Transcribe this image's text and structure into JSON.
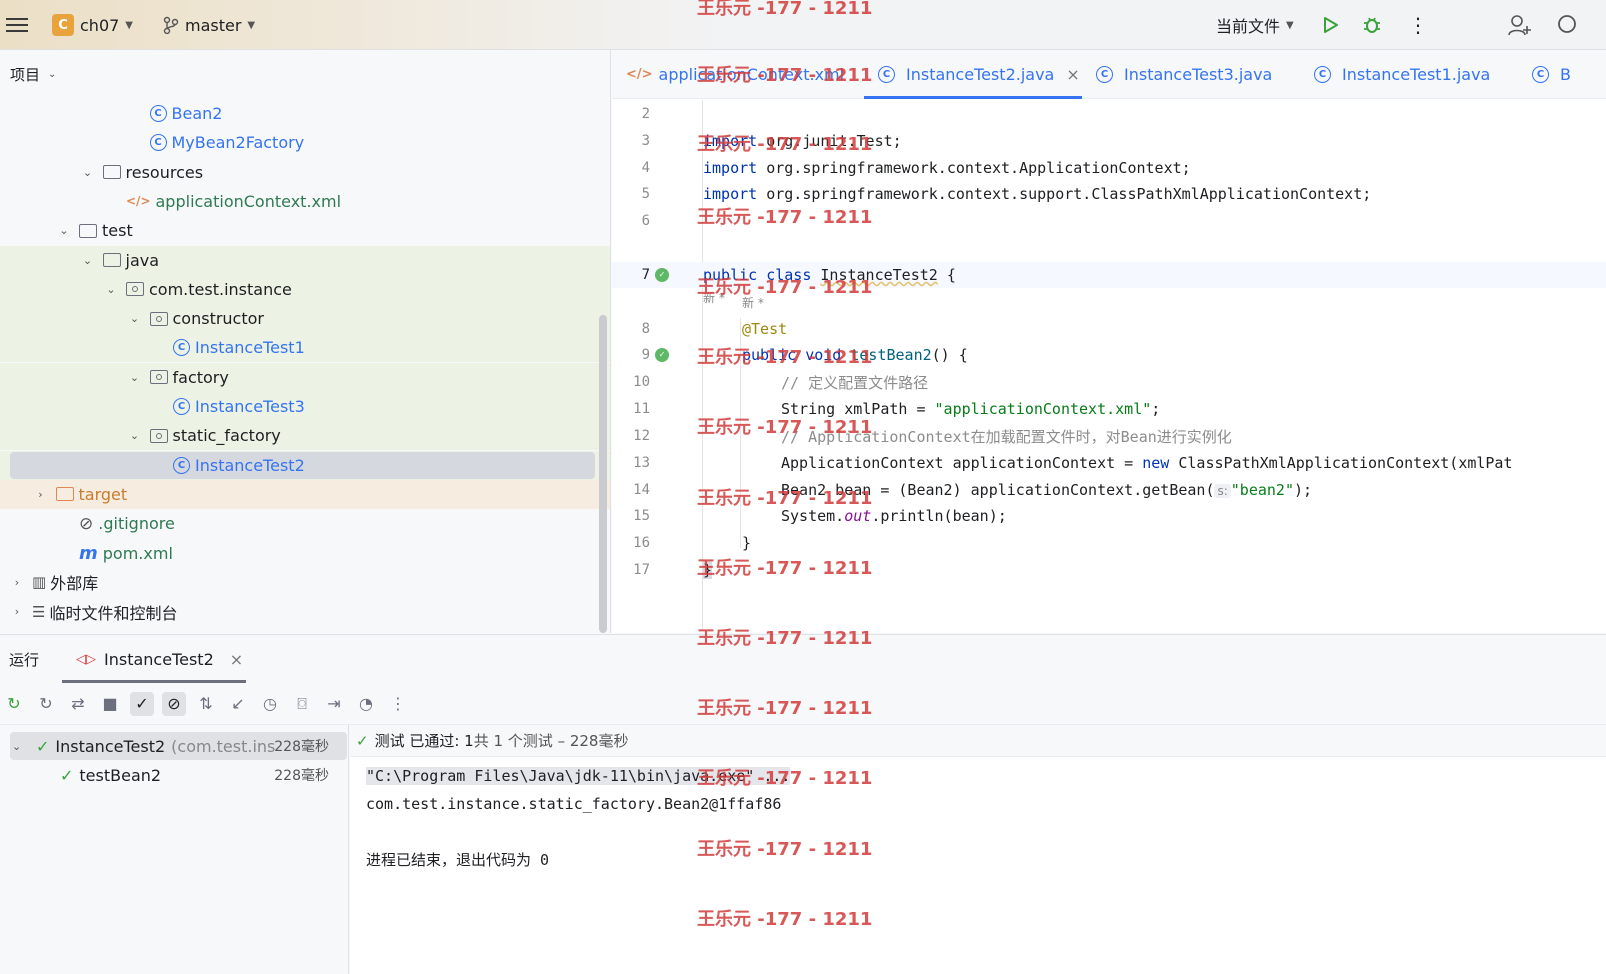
{
  "titlebar": {
    "project_badge": "C",
    "project": "ch07",
    "branch": "master",
    "run_config": "当前文件"
  },
  "left_panel": {
    "title": "项目",
    "tree": [
      {
        "label": "Bean2",
        "kind": "class",
        "indent": 5,
        "arrow": "",
        "row": "plain"
      },
      {
        "label": "MyBean2Factory",
        "kind": "class",
        "indent": 5,
        "arrow": "",
        "row": "plain"
      },
      {
        "label": "resources",
        "kind": "resfolder",
        "indent": 3,
        "arrow": "⌄",
        "row": "plain"
      },
      {
        "label": "applicationContext.xml",
        "kind": "xml",
        "indent": 4,
        "arrow": "",
        "row": "plain"
      },
      {
        "label": "test",
        "kind": "folder",
        "indent": 2,
        "arrow": "⌄",
        "row": "plain"
      },
      {
        "label": "java",
        "kind": "folder",
        "indent": 3,
        "arrow": "⌄",
        "row": "green"
      },
      {
        "label": "com.test.instance",
        "kind": "package",
        "indent": 4,
        "arrow": "⌄",
        "row": "green"
      },
      {
        "label": "constructor",
        "kind": "package",
        "indent": 5,
        "arrow": "⌄",
        "row": "green"
      },
      {
        "label": "InstanceTest1",
        "kind": "class",
        "indent": 6,
        "arrow": "",
        "row": "green"
      },
      {
        "label": "factory",
        "kind": "package",
        "indent": 5,
        "arrow": "⌄",
        "row": "green"
      },
      {
        "label": "InstanceTest3",
        "kind": "class",
        "indent": 6,
        "arrow": "",
        "row": "green"
      },
      {
        "label": "static_factory",
        "kind": "package",
        "indent": 5,
        "arrow": "⌄",
        "row": "green"
      },
      {
        "label": "InstanceTest2",
        "kind": "class",
        "indent": 6,
        "arrow": "",
        "row": "selected"
      },
      {
        "label": "target",
        "kind": "targetfolder",
        "indent": 1,
        "arrow": "›",
        "row": "brown"
      },
      {
        "label": ".gitignore",
        "kind": "ignore",
        "indent": 2,
        "arrow": "",
        "row": "plain"
      },
      {
        "label": "pom.xml",
        "kind": "maven",
        "indent": 2,
        "arrow": "",
        "row": "plain"
      },
      {
        "label": "外部库",
        "kind": "lib",
        "indent": 0,
        "arrow": "›",
        "row": "plain"
      },
      {
        "label": "临时文件和控制台",
        "kind": "scratch",
        "indent": 0,
        "arrow": "›",
        "row": "plain"
      }
    ]
  },
  "editor": {
    "tabs": [
      {
        "label": "applicationContext.xml",
        "icon": "xml"
      },
      {
        "label": "InstanceTest2.java",
        "icon": "class",
        "active": true
      },
      {
        "label": "InstanceTest3.java",
        "icon": "class"
      },
      {
        "label": "InstanceTest1.java",
        "icon": "class"
      },
      {
        "label": "B",
        "icon": "class"
      }
    ],
    "new_marker": "新 *",
    "hint_label": "s:",
    "lines": {
      "l2": "2",
      "l3": "3",
      "l4": "4",
      "l5": "5",
      "l6": "6",
      "l7": "7",
      "l8": "8",
      "l9": "9",
      "l10": "10",
      "l11": "11",
      "l12": "12",
      "l13": "13",
      "l14": "14",
      "l15": "15",
      "l16": "16",
      "l17": "17"
    },
    "code": {
      "import_kw": "import",
      "c3": " org.junit.Test;",
      "c4": " org.springframework.context.ApplicationContext;",
      "c5": " org.springframework.context.support.ClassPathXmlApplicationContext;",
      "public_kw": "public",
      "class_kw": "class",
      "class_name": "InstanceTest2",
      "brace_open": " {",
      "annotation": "@Test",
      "void_kw": "void",
      "method": "testBean2",
      "method_rest": "() {",
      "c10": "// 定义配置文件路径",
      "c11a": "String xmlPath = ",
      "c11s": "\"applicationContext.xml\"",
      "c11b": ";",
      "c12": "// ApplicationContext在加载配置文件时，对Bean进行实例化",
      "c13a": "ApplicationContext applicationContext = ",
      "new_kw": "new",
      "c13b": " ClassPathXmlApplicationContext(xmlPat",
      "c14a": "Bean2 bean = (Bean2) applicationContext.getBean(",
      "c14s": "\"bean2\"",
      "c14b": ");",
      "c15a": "System.",
      "c15i": "out",
      "c15b": ".println(bean);",
      "c16": "}",
      "c17": "}"
    }
  },
  "run": {
    "label": "运行",
    "tab": "InstanceTest2",
    "tree": [
      {
        "label": "InstanceTest2",
        "sub": "(com.test.inst",
        "time": "228毫秒"
      },
      {
        "label": "testBean2",
        "time": "228毫秒"
      }
    ],
    "status_prefix": "测试 已通过: 1",
    "status_suffix": "共 1 个测试 – 228毫秒",
    "console": [
      "\"C:\\Program Files\\Java\\jdk-11\\bin\\java.exe\" ...",
      "com.test.instance.static_factory.Bean2@1ffaf86",
      "",
      "进程已结束，退出代码为 0"
    ]
  },
  "watermark": "王乐元 -177 - 1211",
  "colors": {
    "accent": "#3574f0",
    "pass": "#3aa13b",
    "watermark": "#d23b3b"
  }
}
